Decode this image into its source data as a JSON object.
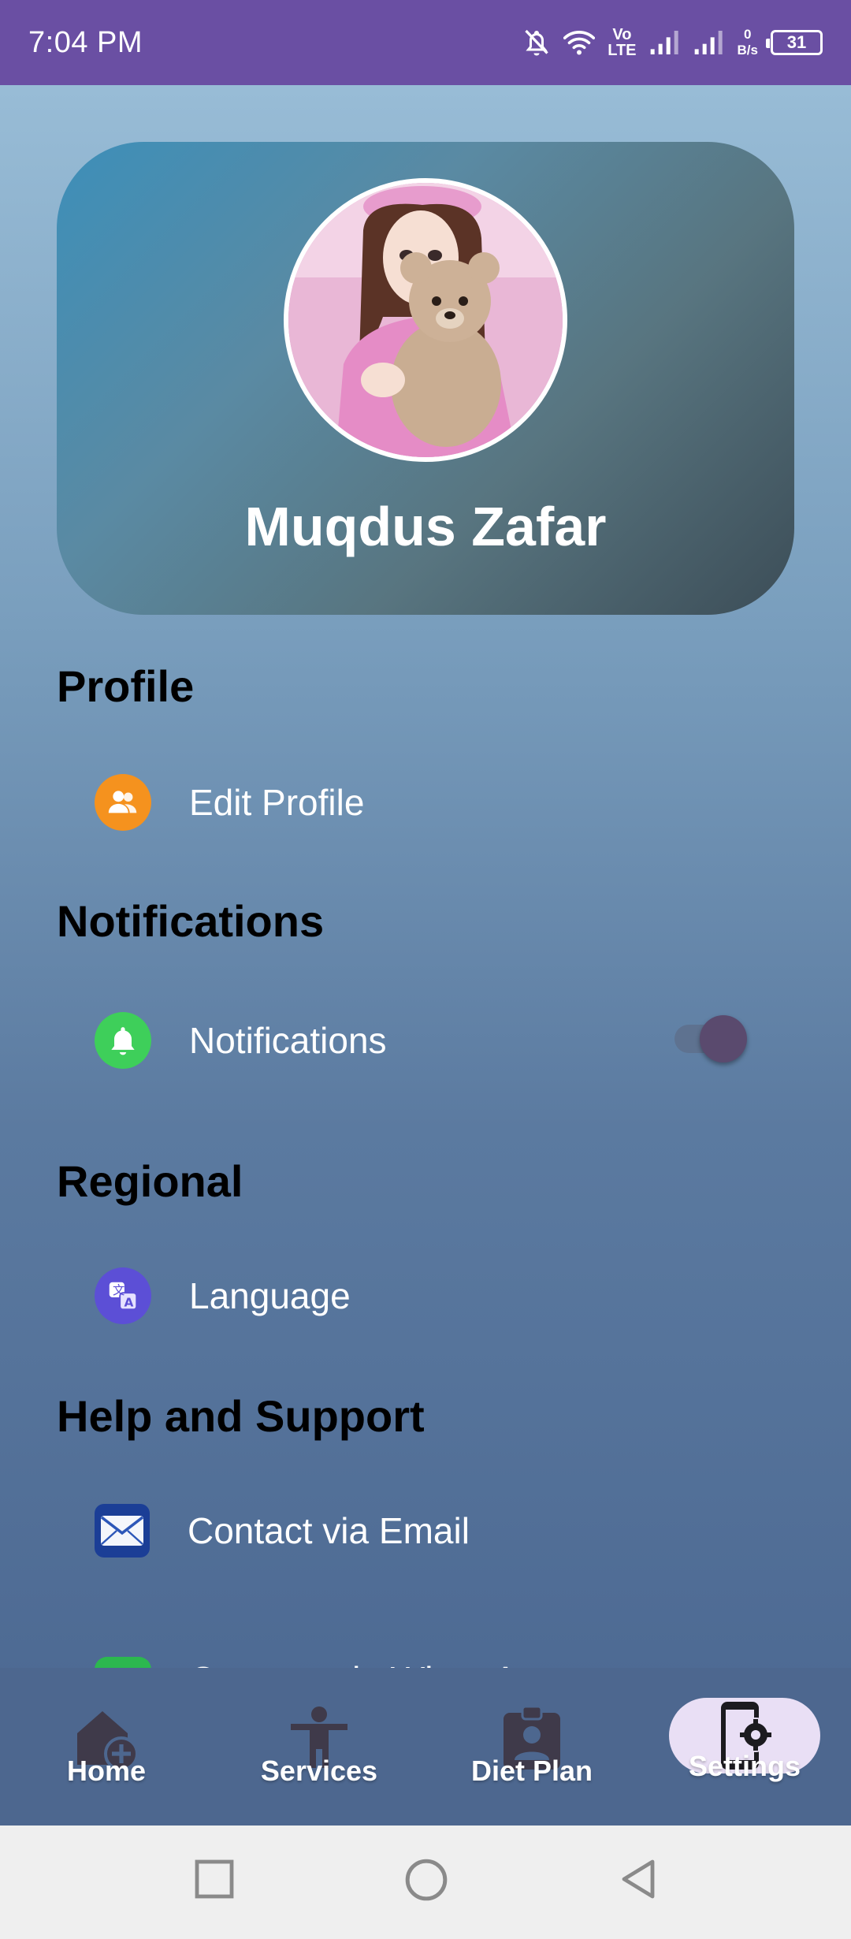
{
  "status_bar": {
    "time": "7:04 PM",
    "volte_top": "Vo",
    "volte_bottom": "LTE",
    "speed_value": "0",
    "speed_unit": "B/s",
    "battery": "31"
  },
  "profile": {
    "name": "Muqdus Zafar"
  },
  "sections": {
    "profile": {
      "heading": "Profile",
      "edit_profile": "Edit Profile"
    },
    "notifications": {
      "heading": "Notifications",
      "notifications_label": "Notifications",
      "enabled": true
    },
    "regional": {
      "heading": "Regional",
      "language": "Language"
    },
    "help": {
      "heading": "Help and Support",
      "contact_email": "Contact via Email",
      "partial_item": "Connect via WhatsApp"
    }
  },
  "bottom_nav": {
    "items": [
      {
        "label": "Home",
        "icon": "home-add-icon"
      },
      {
        "label": "Services",
        "icon": "person-icon"
      },
      {
        "label": "Diet Plan",
        "icon": "clipboard-person-icon"
      },
      {
        "label": "Settings",
        "icon": "phone-settings-icon",
        "active": true
      }
    ]
  },
  "colors": {
    "status_bar": "#6a4fa3",
    "edit_profile_icon": "#f5921e",
    "notifications_icon": "#3ecf5a",
    "language_icon": "#5c4fd6",
    "nav_active_pill": "#e9dff5"
  }
}
